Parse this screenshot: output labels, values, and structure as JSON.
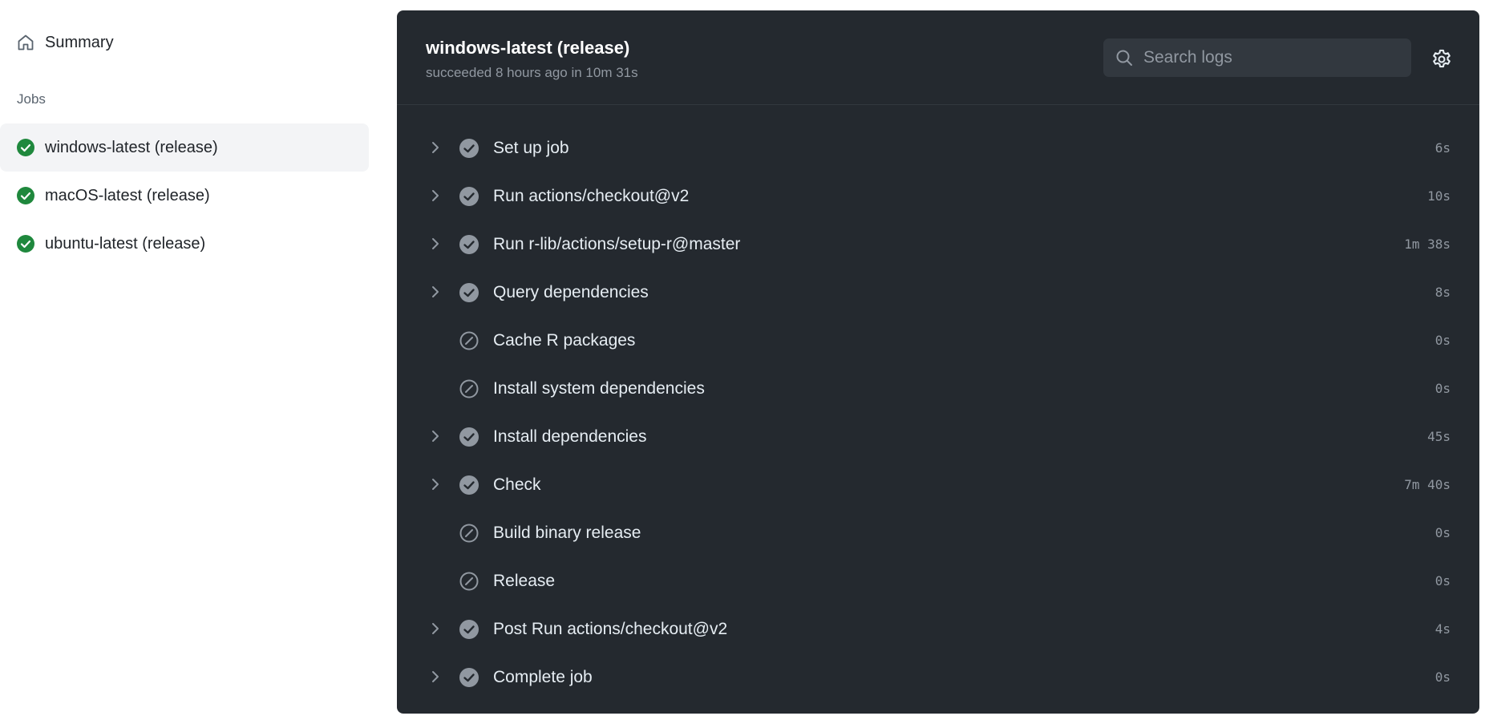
{
  "sidebar": {
    "summary_label": "Summary",
    "summary_icon": "home-icon",
    "jobs_heading": "Jobs",
    "jobs": [
      {
        "label": "windows-latest (release)",
        "status": "success",
        "active": true
      },
      {
        "label": "macOS-latest (release)",
        "status": "success",
        "active": false
      },
      {
        "label": "ubuntu-latest (release)",
        "status": "success",
        "active": false
      }
    ]
  },
  "panel": {
    "title": "windows-latest (release)",
    "meta": "succeeded 8 hours ago in 10m 31s",
    "search_placeholder": "Search logs",
    "settings_icon": "gear-icon",
    "steps": [
      {
        "name": "Set up job",
        "duration": "6s",
        "status": "success",
        "expandable": true
      },
      {
        "name": "Run actions/checkout@v2",
        "duration": "10s",
        "status": "success",
        "expandable": true
      },
      {
        "name": "Run r-lib/actions/setup-r@master",
        "duration": "1m 38s",
        "status": "success",
        "expandable": true
      },
      {
        "name": "Query dependencies",
        "duration": "8s",
        "status": "success",
        "expandable": true
      },
      {
        "name": "Cache R packages",
        "duration": "0s",
        "status": "skipped",
        "expandable": false
      },
      {
        "name": "Install system dependencies",
        "duration": "0s",
        "status": "skipped",
        "expandable": false
      },
      {
        "name": "Install dependencies",
        "duration": "45s",
        "status": "success",
        "expandable": true
      },
      {
        "name": "Check",
        "duration": "7m 40s",
        "status": "success",
        "expandable": true
      },
      {
        "name": "Build binary release",
        "duration": "0s",
        "status": "skipped",
        "expandable": false
      },
      {
        "name": "Release",
        "duration": "0s",
        "status": "skipped",
        "expandable": false
      },
      {
        "name": "Post Run actions/checkout@v2",
        "duration": "4s",
        "status": "success",
        "expandable": true
      },
      {
        "name": "Complete job",
        "duration": "0s",
        "status": "success",
        "expandable": true
      }
    ]
  },
  "colors": {
    "success_green": "#1f883d",
    "panel_bg": "#24292f",
    "step_icon_grey": "#9198a1"
  }
}
